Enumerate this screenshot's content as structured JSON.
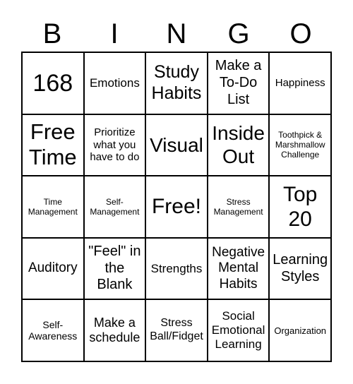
{
  "header": [
    "B",
    "I",
    "N",
    "G",
    "O"
  ],
  "cells": [
    "168",
    "Emotions",
    "Study Habits",
    "Make a To-Do List",
    "Happiness",
    "Free Time",
    "Prioritize what you have to do",
    "Visual",
    "Inside Out",
    "Toothpick & Marshmallow Challenge",
    "Time Management",
    "Self-Management",
    "Free!",
    "Stress Management",
    "Top 20",
    "Auditory",
    "\"Feel\" in the Blank",
    "Strengths",
    "Negative Mental Habits",
    "Learning Styles",
    "Self-Awareness",
    "Make a schedule",
    "Stress Ball/Fidget",
    "Social Emotional Learning",
    "Organization"
  ]
}
